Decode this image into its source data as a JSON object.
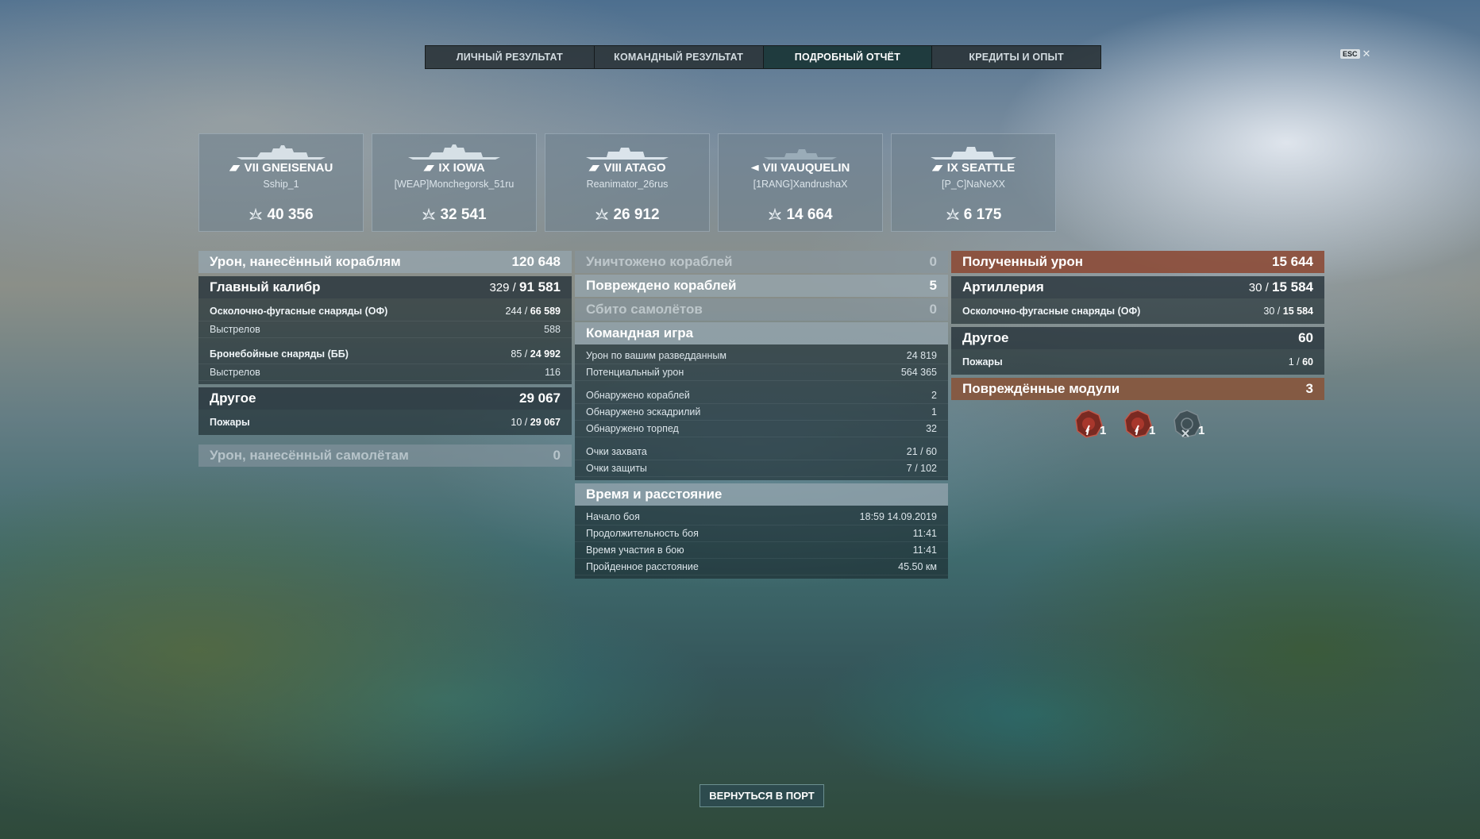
{
  "tabs": [
    {
      "label": "ЛИЧНЫЙ РЕЗУЛЬТАТ",
      "active": false
    },
    {
      "label": "КОМАНДНЫЙ РЕЗУЛЬТАТ",
      "active": false
    },
    {
      "label": "ПОДРОБНЫЙ ОТЧЁТ",
      "active": true
    },
    {
      "label": "КРЕДИТЫ И ОПЫТ",
      "active": false
    }
  ],
  "esc": {
    "key": "ESC",
    "close": "✕"
  },
  "ships": [
    {
      "name": "VII GNEISENAU",
      "player": "Sship_1",
      "damage": "40 356",
      "class_icon": "battleship-icon"
    },
    {
      "name": "IX IOWA",
      "player": "[WEAP]Monchegorsk_51ru",
      "damage": "32 541",
      "class_icon": "battleship-icon"
    },
    {
      "name": "VIII ATAGO",
      "player": "Reanimator_26rus",
      "damage": "26 912",
      "class_icon": "cruiser-icon"
    },
    {
      "name": "VII VAUQUELIN",
      "player": "[1RANG]XandrushaX",
      "damage": "14 664",
      "class_icon": "destroyer-icon"
    },
    {
      "name": "IX SEATTLE",
      "player": "[P_C]NaNeXX",
      "damage": "6 175",
      "class_icon": "cruiser-icon"
    }
  ],
  "left": {
    "dealt": {
      "label": "Урон, нанесённый кораблям",
      "value": "120 648"
    },
    "main_battery": {
      "label": "Главный калибр",
      "hits": "329 /",
      "value": "91 581"
    },
    "he": {
      "label": "Осколочно-фугасные снаряды (ОФ)",
      "hits": "244 /",
      "value": "66 589"
    },
    "he_shots": {
      "label": "Выстрелов",
      "value": "588"
    },
    "ap": {
      "label": "Бронебойные снаряды (ББ)",
      "hits": "85 /",
      "value": "24 992"
    },
    "ap_shots": {
      "label": "Выстрелов",
      "value": "116"
    },
    "other": {
      "label": "Другое",
      "value": "29 067"
    },
    "fires": {
      "label": "Пожары",
      "hits": "10 /",
      "value": "29 067"
    },
    "planes": {
      "label": "Урон, нанесённый самолётам",
      "value": "0"
    }
  },
  "middle": {
    "destroyed": {
      "label": "Уничтожено кораблей",
      "value": "0"
    },
    "damaged": {
      "label": "Повреждено кораблей",
      "value": "5"
    },
    "planes_down": {
      "label": "Сбито самолётов",
      "value": "0"
    },
    "team": {
      "label": "Командная игра",
      "rows": [
        {
          "label": "Урон по вашим разведданным",
          "value": "24 819"
        },
        {
          "label": "Потенциальный урон",
          "value": "564 365"
        },
        {
          "label": "Обнаружено кораблей",
          "value": "2"
        },
        {
          "label": "Обнаружено эскадрилий",
          "value": "1"
        },
        {
          "label": "Обнаружено торпед",
          "value": "32"
        },
        {
          "label": "Очки захвата",
          "value": "21 / 60"
        },
        {
          "label": "Очки защиты",
          "value": "7 / 102"
        }
      ]
    },
    "time": {
      "label": "Время и расстояние",
      "rows": [
        {
          "label": "Начало боя",
          "value": "18:59  14.09.2019"
        },
        {
          "label": "Продолжительность боя",
          "value": "11:41"
        },
        {
          "label": "Время участия в бою",
          "value": "11:41"
        },
        {
          "label": "Пройденное расстояние",
          "value": "45.50 км"
        }
      ]
    }
  },
  "right": {
    "received": {
      "label": "Полученный урон",
      "value": "15 644"
    },
    "artillery": {
      "label": "Артиллерия",
      "hits": "30 /",
      "value": "15 584"
    },
    "he": {
      "label": "Осколочно-фугасные снаряды (ОФ)",
      "hits": "30 /",
      "value": "15 584"
    },
    "other": {
      "label": "Другое",
      "value": "60"
    },
    "fires": {
      "label": "Пожары",
      "hits": "1 /",
      "value": "60"
    },
    "modules": {
      "label": "Повреждённые модули",
      "value": "3"
    },
    "module_icons": [
      {
        "icon": "damaged-module-icon",
        "count": "1"
      },
      {
        "icon": "damaged-module-icon",
        "count": "1"
      },
      {
        "icon": "destroyed-module-icon",
        "count": "1"
      }
    ]
  },
  "port_button": "ВЕРНУТЬСЯ В ПОРТ",
  "colors": {
    "active_tab": "#1e3c3e",
    "received_header": "#8c4b37"
  }
}
